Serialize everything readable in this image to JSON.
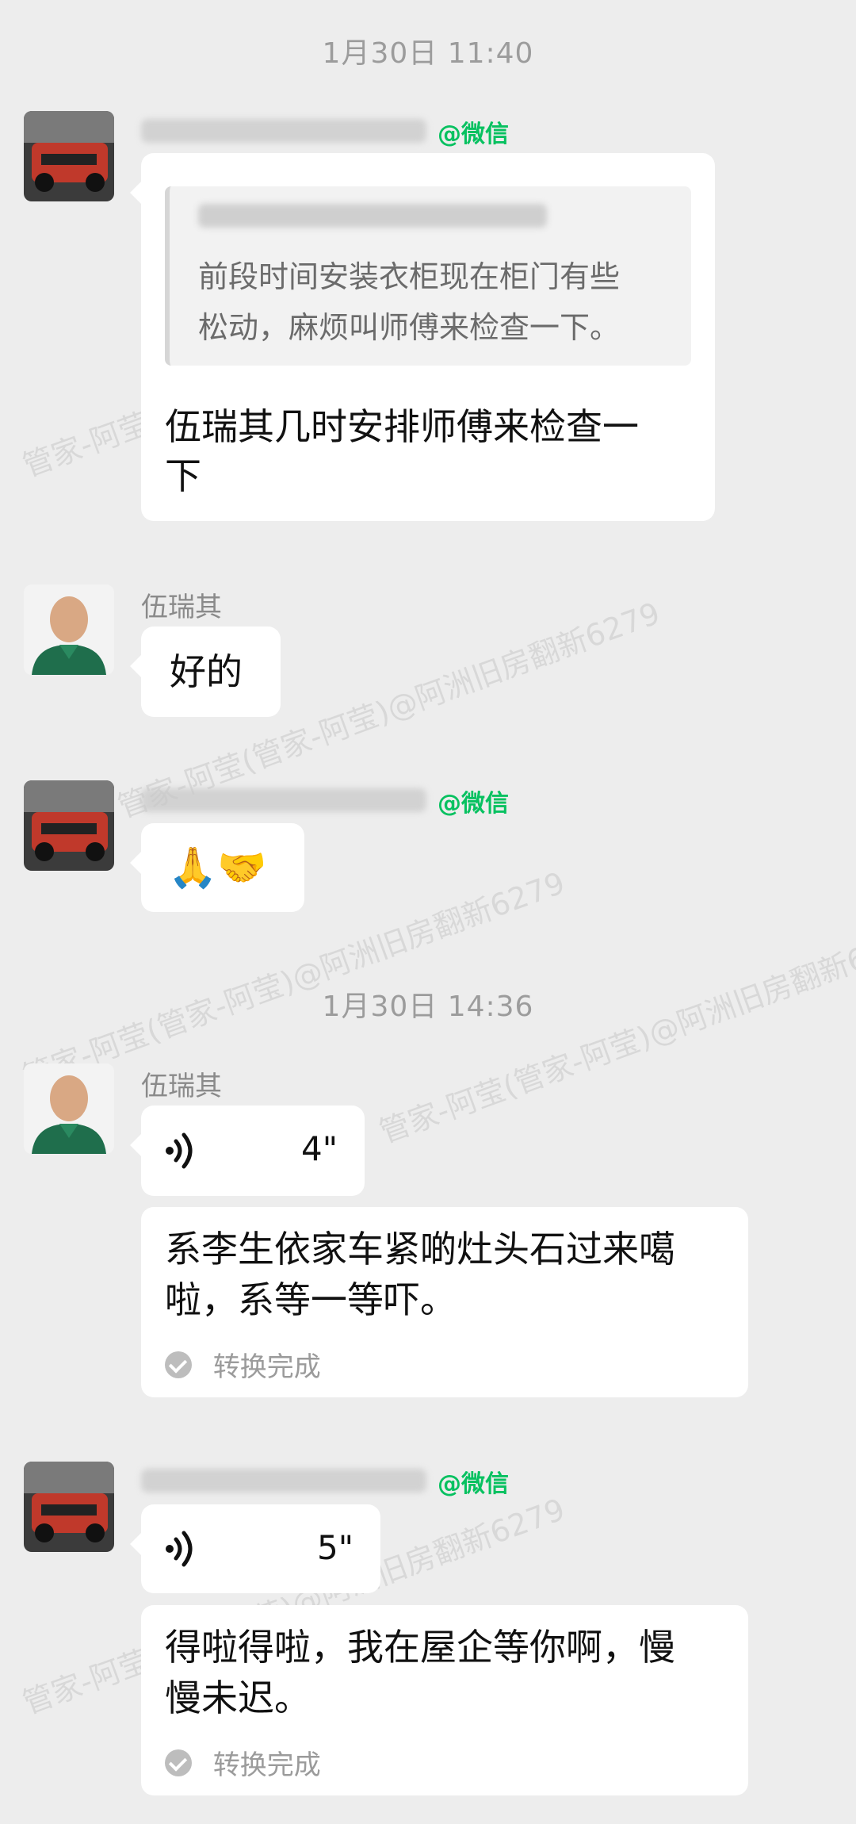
{
  "timestamps": [
    "1月30日  11:40",
    "1月30日  14:36"
  ],
  "sender_name": "伍瑞其",
  "wechat_tag": "@微信",
  "quote_lines": [
    "前段时间安装衣柜现在柜门有些",
    "松动，麻烦叫师傅来检查一下。"
  ],
  "msg1_lines": [
    "伍瑞其几时安排师傅来检查一",
    "下"
  ],
  "msg2": "好的",
  "msg3_emoji": "🙏🤝",
  "voice1_duration": "4\"",
  "voice1_text_lines": [
    "系李生依家车紧啲灶头石过来噶",
    "啦，系等一等吓。"
  ],
  "voice2_duration": "5\"",
  "voice2_text_lines": [
    "得啦得啦，我在屋企等你啊，慢",
    "慢未迟。"
  ],
  "conversion_done": "转换完成",
  "watermarks": [
    "管家-阿莹(管家-阿莹)@阿洲旧房翻新6279",
    "管家-阿莹(管家-阿莹)@阿洲旧房翻新6279",
    "管家-阿莹(管家-阿莹)@阿洲旧房翻新6279",
    "管家-阿莹(管家-阿莹)@阿洲旧房翻新6279",
    "管家-阿莹(管家-阿莹)@阿洲旧房翻新6279"
  ],
  "colors": {
    "background": "#EDEDED",
    "bubble": "#FFFFFF",
    "wechat_green": "#07C160",
    "avatar_car": "#C0392B",
    "avatar_shirt": "#1F6E4C"
  }
}
